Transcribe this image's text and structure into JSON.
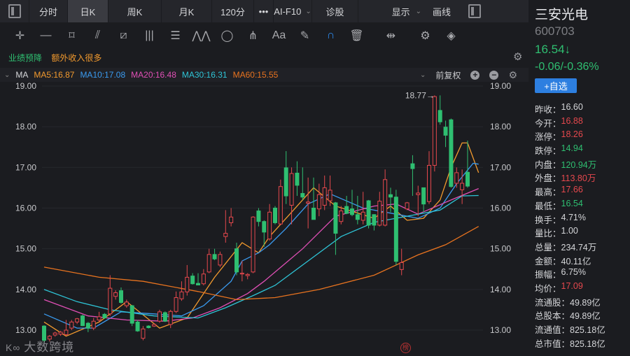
{
  "topbar": {
    "tabs": [
      "分时",
      "日K",
      "周K",
      "月K",
      "120分"
    ],
    "active_tab": "日K",
    "more": "•••",
    "ai_f10": "AI-F10",
    "diagnose": "诊股",
    "display": "显示",
    "draw": "画线"
  },
  "tools": [
    "crosshair-icon",
    "line-icon",
    "rect-icon",
    "fan-icon",
    "channel-icon",
    "vlines-icon",
    "fib-icon",
    "wave-icon",
    "ellipse-icon",
    "pitchfork-icon",
    "text-icon",
    "eraser-icon",
    "magnet-icon",
    "trash-icon",
    "split-icon",
    "gear-icon",
    "layers-icon"
  ],
  "notes": {
    "tag1": "业绩预降",
    "tag2": "额外收入很多"
  },
  "ma": {
    "label": "MA",
    "ma5": "MA5:16.87",
    "ma10": "MA10:17.08",
    "ma20": "MA20:16.48",
    "ma30": "MA30:16.31",
    "ma60": "MA60:15.55",
    "adjust": "前复权"
  },
  "colors": {
    "up": "#e5484d",
    "down": "#2fbf71",
    "ma5": "#f29a2e",
    "ma10": "#3a9bf0",
    "ma20": "#e04fb5",
    "ma30": "#2ec4d6",
    "ma60": "#e8731f"
  },
  "stock": {
    "name": "三安光电",
    "code": "600703",
    "price": "16.54↓",
    "change": "-0.06/-0.36%",
    "watch": "+自选"
  },
  "stats": [
    {
      "k": "昨收：",
      "v": "16.60",
      "c": "white"
    },
    {
      "k": "今开：",
      "v": "16.88",
      "c": "red"
    },
    {
      "k": "涨停：",
      "v": "18.26",
      "c": "red"
    },
    {
      "k": "跌停：",
      "v": "14.94",
      "c": "green"
    },
    {
      "k": "内盘：",
      "v": "120.94万",
      "c": "green"
    },
    {
      "k": "外盘：",
      "v": "113.80万",
      "c": "red"
    },
    {
      "k": "最高：",
      "v": "17.66",
      "c": "red"
    },
    {
      "k": "最低：",
      "v": "16.54",
      "c": "green"
    },
    {
      "k": "换手：",
      "v": "4.71%",
      "c": "white"
    },
    {
      "k": "量比：",
      "v": "1.00",
      "c": "white"
    },
    {
      "k": "总量：",
      "v": "234.74万",
      "c": "white"
    },
    {
      "k": "金额：",
      "v": "40.11亿",
      "c": "white"
    },
    {
      "k": "振幅：",
      "v": "6.75%",
      "c": "white"
    },
    {
      "k": "均价：",
      "v": "17.09",
      "c": "red"
    },
    {
      "k": "流通股：",
      "v": "49.89亿",
      "c": "white"
    },
    {
      "k": "总股本：",
      "v": "49.89亿",
      "c": "white"
    },
    {
      "k": "流通值：",
      "v": "825.18亿",
      "c": "white"
    },
    {
      "k": "总市值：",
      "v": "825.18亿",
      "c": "white"
    }
  ],
  "watermark": "大数跨境",
  "seal": "榜",
  "chart_data": {
    "type": "candlestick",
    "yticks": [
      "19.00",
      "18.00",
      "17.00",
      "16.00",
      "15.00",
      "14.00",
      "13.00"
    ],
    "ylim": [
      12.6,
      19.1
    ],
    "max_label": "18.77→",
    "ohlc": [
      [
        13.1,
        13.12,
        12.7,
        12.75
      ],
      [
        12.78,
        12.88,
        12.72,
        12.85
      ],
      [
        12.88,
        12.96,
        12.84,
        12.93
      ],
      [
        12.9,
        12.98,
        12.86,
        12.95
      ],
      [
        12.89,
        13.25,
        12.86,
        13.0
      ],
      [
        13.05,
        13.25,
        13.0,
        13.2
      ],
      [
        13.2,
        13.3,
        13.15,
        13.28
      ],
      [
        13.35,
        13.38,
        13.1,
        13.11
      ],
      [
        13.17,
        13.2,
        12.95,
        13.05
      ],
      [
        13.05,
        13.3,
        13.0,
        13.22
      ],
      [
        13.25,
        13.45,
        13.2,
        13.33
      ],
      [
        13.39,
        13.42,
        13.28,
        13.3
      ],
      [
        13.4,
        14.35,
        13.35,
        14.03
      ],
      [
        13.83,
        13.98,
        13.75,
        13.92
      ],
      [
        13.97,
        14.05,
        13.65,
        13.68
      ],
      [
        13.6,
        13.75,
        13.55,
        13.69
      ],
      [
        13.6,
        13.62,
        13.1,
        13.17
      ],
      [
        13.2,
        13.25,
        12.96,
        12.98
      ],
      [
        12.8,
        13.1,
        12.75,
        13.03
      ],
      [
        13.1,
        13.12,
        13.04,
        13.06
      ],
      [
        13.1,
        13.16,
        13.08,
        13.14
      ],
      [
        13.22,
        13.5,
        13.18,
        13.45
      ],
      [
        13.43,
        13.46,
        13.2,
        13.22
      ],
      [
        13.14,
        13.5,
        13.05,
        13.46
      ],
      [
        13.46,
        13.95,
        13.42,
        13.8
      ],
      [
        13.77,
        14.2,
        13.72,
        13.94
      ],
      [
        13.94,
        14.6,
        13.85,
        14.3
      ],
      [
        14.33,
        14.4,
        14.12,
        14.14
      ],
      [
        14.15,
        14.4,
        14.1,
        14.11
      ],
      [
        14.14,
        14.5,
        14.1,
        14.38
      ],
      [
        14.43,
        15.0,
        14.4,
        14.86
      ],
      [
        14.86,
        15.0,
        14.72,
        14.75
      ],
      [
        14.6,
        14.93,
        14.55,
        14.86
      ],
      [
        15.3,
        15.95,
        15.15,
        15.38
      ],
      [
        15.64,
        16.0,
        15.55,
        15.78
      ],
      [
        15.0,
        15.15,
        14.35,
        14.43
      ],
      [
        14.38,
        14.7,
        14.2,
        14.4
      ],
      [
        14.34,
        14.4,
        14.25,
        14.37
      ],
      [
        14.43,
        15.8,
        14.4,
        15.78
      ],
      [
        15.93,
        16.0,
        15.55,
        15.67
      ],
      [
        15.67,
        15.7,
        15.05,
        15.41
      ],
      [
        15.24,
        16.1,
        15.2,
        15.9
      ],
      [
        16.0,
        16.05,
        15.6,
        15.64
      ],
      [
        15.61,
        16.7,
        15.58,
        16.53
      ],
      [
        16.99,
        17.4,
        16.1,
        16.3
      ],
      [
        16.07,
        17.0,
        15.6,
        16.85
      ],
      [
        16.86,
        17.15,
        16.3,
        16.56
      ],
      [
        16.36,
        17.0,
        16.2,
        16.27
      ],
      [
        16.12,
        16.75,
        15.5,
        16.15
      ],
      [
        16.0,
        16.75,
        15.85,
        15.72
      ],
      [
        15.98,
        16.6,
        15.8,
        16.33
      ],
      [
        16.07,
        16.8,
        15.95,
        16.5
      ],
      [
        16.18,
        16.8,
        16.05,
        16.44
      ],
      [
        16.13,
        16.15,
        14.85,
        15.38
      ],
      [
        15.67,
        16.05,
        15.6,
        15.93
      ],
      [
        16.04,
        16.3,
        15.85,
        15.87
      ],
      [
        15.98,
        16.45,
        15.8,
        15.84
      ],
      [
        15.84,
        16.3,
        15.6,
        15.72
      ],
      [
        15.7,
        16.4,
        15.6,
        15.9
      ],
      [
        16.18,
        16.2,
        15.5,
        15.58
      ],
      [
        15.84,
        15.85,
        15.45,
        15.58
      ],
      [
        15.58,
        16.4,
        15.55,
        16.17
      ],
      [
        15.58,
        16.95,
        15.55,
        16.7
      ],
      [
        16.33,
        16.5,
        15.9,
        16.27
      ],
      [
        16.27,
        16.45,
        14.6,
        14.69
      ],
      [
        14.49,
        15.0,
        14.35,
        14.66
      ],
      [
        15.98,
        16.15,
        15.95,
        16.13
      ],
      [
        17.09,
        17.3,
        16.3,
        16.97
      ],
      [
        16.33,
        16.55,
        15.8,
        16.37
      ],
      [
        16.5,
        16.5,
        15.9,
        16.1
      ],
      [
        16.16,
        17.4,
        16.1,
        17.05
      ],
      [
        17.05,
        18.77,
        16.9,
        18.74
      ],
      [
        18.4,
        18.77,
        18.05,
        18.12
      ],
      [
        17.99,
        18.15,
        17.5,
        17.79
      ],
      [
        18.17,
        18.2,
        16.5,
        16.53
      ],
      [
        16.61,
        17.0,
        16.5,
        16.87
      ],
      [
        16.45,
        16.95,
        16.1,
        16.61
      ],
      [
        16.88,
        17.66,
        16.5,
        16.54
      ]
    ],
    "ma_series": [
      {
        "name": "MA5",
        "color": "#f29a2e",
        "points": [
          [
            0,
            13.2
          ],
          [
            4,
            12.85
          ],
          [
            10,
            13.2
          ],
          [
            15,
            13.7
          ],
          [
            21,
            13.05
          ],
          [
            26,
            13.3
          ],
          [
            31,
            14.3
          ],
          [
            36,
            15.15
          ],
          [
            39,
            14.9
          ],
          [
            41,
            15.3
          ],
          [
            45,
            15.9
          ],
          [
            49,
            16.5
          ],
          [
            53,
            16.05
          ],
          [
            60,
            15.75
          ],
          [
            63,
            16.05
          ],
          [
            66,
            15.7
          ],
          [
            69,
            15.75
          ],
          [
            72,
            16.2
          ],
          [
            74,
            17.0
          ],
          [
            76,
            17.6
          ],
          [
            77,
            17.6
          ],
          [
            79,
            16.87
          ]
        ]
      },
      {
        "name": "MA10",
        "color": "#3a9bf0",
        "points": [
          [
            0,
            13.4
          ],
          [
            6,
            13.05
          ],
          [
            9,
            13.05
          ],
          [
            14,
            13.45
          ],
          [
            20,
            13.4
          ],
          [
            25,
            13.35
          ],
          [
            29,
            13.6
          ],
          [
            34,
            14.2
          ],
          [
            36,
            14.7
          ],
          [
            39,
            14.9
          ],
          [
            41,
            15.1
          ],
          [
            44,
            15.5
          ],
          [
            48,
            16.1
          ],
          [
            52,
            16.35
          ],
          [
            58,
            16.0
          ],
          [
            64,
            15.85
          ],
          [
            68,
            15.75
          ],
          [
            72,
            16.0
          ],
          [
            75,
            16.6
          ],
          [
            78,
            17.1
          ],
          [
            79,
            17.08
          ]
        ]
      },
      {
        "name": "MA20",
        "color": "#e04fb5",
        "points": [
          [
            0,
            13.75
          ],
          [
            8,
            13.35
          ],
          [
            15,
            13.25
          ],
          [
            22,
            13.22
          ],
          [
            27,
            13.3
          ],
          [
            32,
            13.55
          ],
          [
            37,
            13.9
          ],
          [
            40,
            14.2
          ],
          [
            47,
            15.0
          ],
          [
            53,
            15.8
          ],
          [
            60,
            16.05
          ],
          [
            64,
            16.1
          ],
          [
            68,
            15.85
          ],
          [
            74,
            16.2
          ],
          [
            79,
            16.48
          ]
        ]
      },
      {
        "name": "MA30",
        "color": "#2ec4d6",
        "points": [
          [
            0,
            14.0
          ],
          [
            6,
            13.7
          ],
          [
            12,
            13.5
          ],
          [
            20,
            13.35
          ],
          [
            28,
            13.3
          ],
          [
            33,
            13.55
          ],
          [
            38,
            13.85
          ],
          [
            42,
            14.1
          ],
          [
            48,
            14.7
          ],
          [
            54,
            15.3
          ],
          [
            60,
            15.65
          ],
          [
            66,
            15.8
          ],
          [
            72,
            15.95
          ],
          [
            76,
            16.3
          ],
          [
            79,
            16.31
          ]
        ]
      },
      {
        "name": "MA60",
        "color": "#e8731f",
        "points": [
          [
            0,
            14.55
          ],
          [
            10,
            14.3
          ],
          [
            18,
            14.2
          ],
          [
            28,
            13.95
          ],
          [
            35,
            13.75
          ],
          [
            42,
            13.8
          ],
          [
            50,
            14.0
          ],
          [
            60,
            14.35
          ],
          [
            68,
            14.85
          ],
          [
            73,
            15.1
          ],
          [
            79,
            15.55
          ]
        ]
      }
    ]
  }
}
